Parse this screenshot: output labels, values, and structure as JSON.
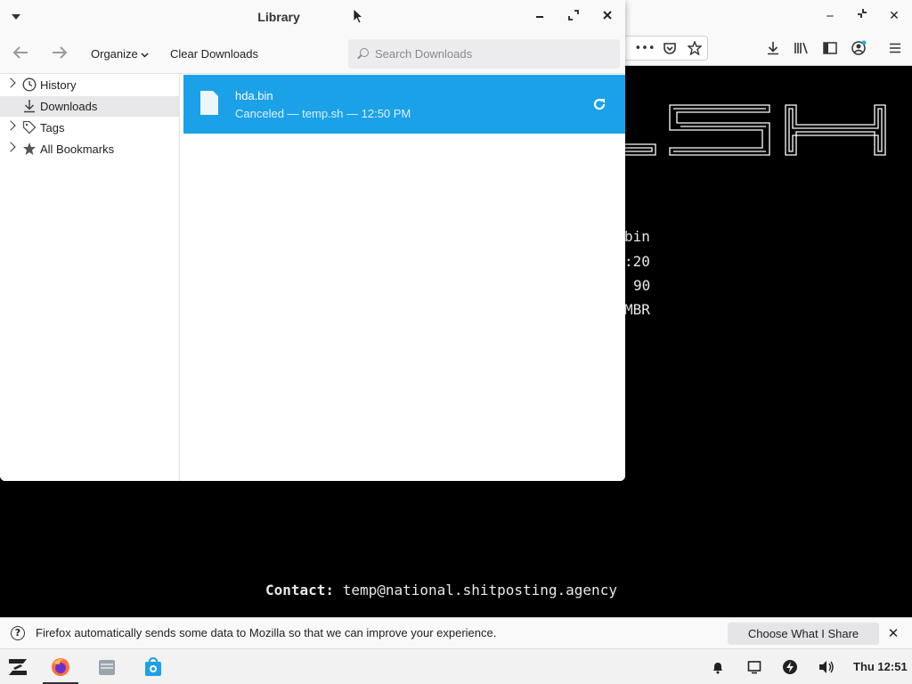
{
  "library": {
    "title": "Library",
    "toolbar": {
      "organize_label": "Organize",
      "clear_label": "Clear Downloads",
      "search_placeholder": "Search Downloads"
    },
    "sidebar": {
      "items": [
        {
          "label": "History",
          "icon": "clock-icon",
          "expandable": true,
          "selected": false
        },
        {
          "label": "Downloads",
          "icon": "download-icon",
          "expandable": false,
          "selected": true
        },
        {
          "label": "Tags",
          "icon": "tag-icon",
          "expandable": true,
          "selected": false
        },
        {
          "label": "All Bookmarks",
          "icon": "star-icon",
          "expandable": true,
          "selected": false
        }
      ]
    },
    "downloads": [
      {
        "name": "hda.bin",
        "status": "Canceled — temp.sh — 12:50 PM",
        "icon": "file-icon",
        "action_icon": "retry-icon"
      }
    ],
    "colors": {
      "selection": "#1ba1e8"
    }
  },
  "page": {
    "terminal_fragments": [
      "bin",
      ":20",
      "90",
      "MBR"
    ],
    "contact_label": "Contact:",
    "contact_value": "temp@national.shitposting.agency"
  },
  "notification": {
    "text": "Firefox automatically sends some data to Mozilla so that we can improve your experience.",
    "button_label": "Choose What I Share"
  },
  "taskbar": {
    "clock": "Thu 12:51"
  }
}
